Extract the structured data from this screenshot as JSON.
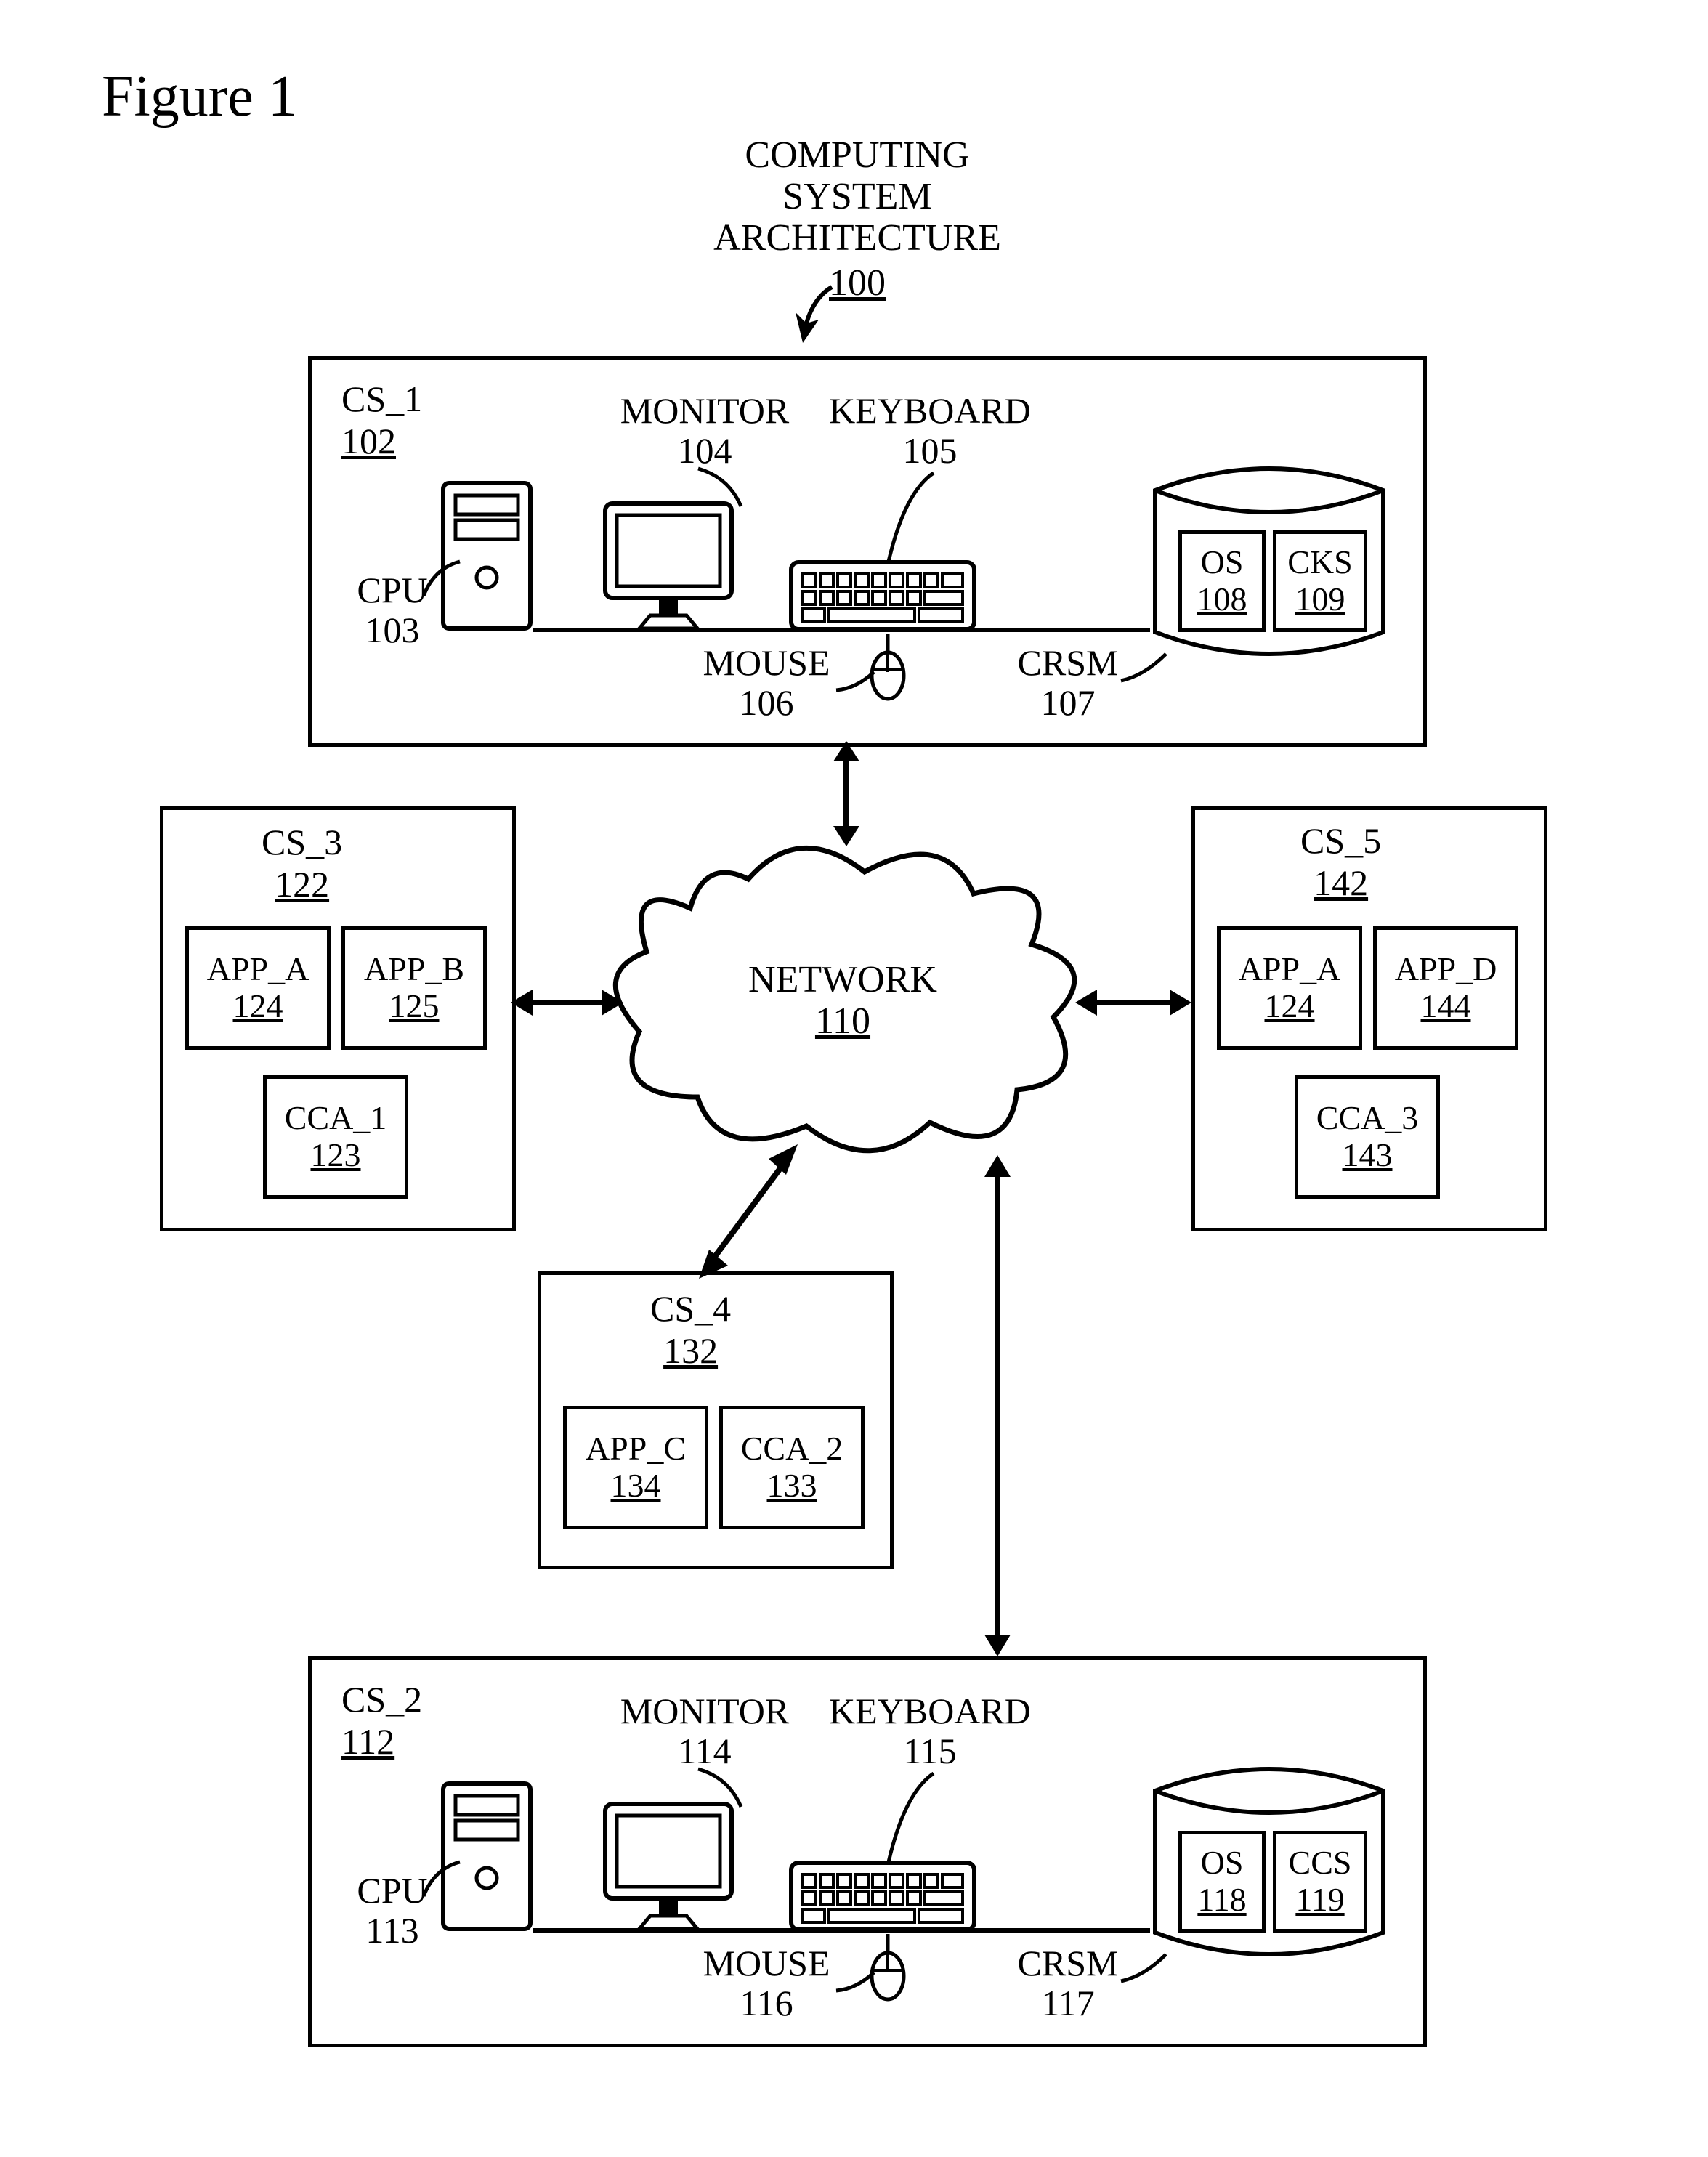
{
  "figure_label": "Figure 1",
  "title": {
    "l1": "COMPUTING",
    "l2": "SYSTEM",
    "l3": "ARCHITECTURE",
    "ref": "100"
  },
  "network": {
    "name": "NETWORK",
    "ref": "110"
  },
  "cs1": {
    "name": "CS_1",
    "ref": "102",
    "monitor": {
      "name": "MONITOR",
      "ref": "104"
    },
    "keyboard": {
      "name": "KEYBOARD",
      "ref": "105"
    },
    "cpu": {
      "name": "CPU",
      "ref": "103"
    },
    "mouse": {
      "name": "MOUSE",
      "ref": "106"
    },
    "crsm": {
      "name": "CRSM",
      "ref": "107"
    },
    "os": {
      "name": "OS",
      "ref": "108"
    },
    "cks": {
      "name": "CKS",
      "ref": "109"
    }
  },
  "cs2": {
    "name": "CS_2",
    "ref": "112",
    "monitor": {
      "name": "MONITOR",
      "ref": "114"
    },
    "keyboard": {
      "name": "KEYBOARD",
      "ref": "115"
    },
    "cpu": {
      "name": "CPU",
      "ref": "113"
    },
    "mouse": {
      "name": "MOUSE",
      "ref": "116"
    },
    "crsm": {
      "name": "CRSM",
      "ref": "117"
    },
    "os": {
      "name": "OS",
      "ref": "118"
    },
    "ccs": {
      "name": "CCS",
      "ref": "119"
    }
  },
  "cs3": {
    "name": "CS_3",
    "ref": "122",
    "app_a": {
      "name": "APP_A",
      "ref": "124"
    },
    "app_b": {
      "name": "APP_B",
      "ref": "125"
    },
    "cca": {
      "name": "CCA_1",
      "ref": "123"
    }
  },
  "cs4": {
    "name": "CS_4",
    "ref": "132",
    "app_c": {
      "name": "APP_C",
      "ref": "134"
    },
    "cca": {
      "name": "CCA_2",
      "ref": "133"
    }
  },
  "cs5": {
    "name": "CS_5",
    "ref": "142",
    "app_a": {
      "name": "APP_A",
      "ref": "124"
    },
    "app_d": {
      "name": "APP_D",
      "ref": "144"
    },
    "cca": {
      "name": "CCA_3",
      "ref": "143"
    }
  }
}
